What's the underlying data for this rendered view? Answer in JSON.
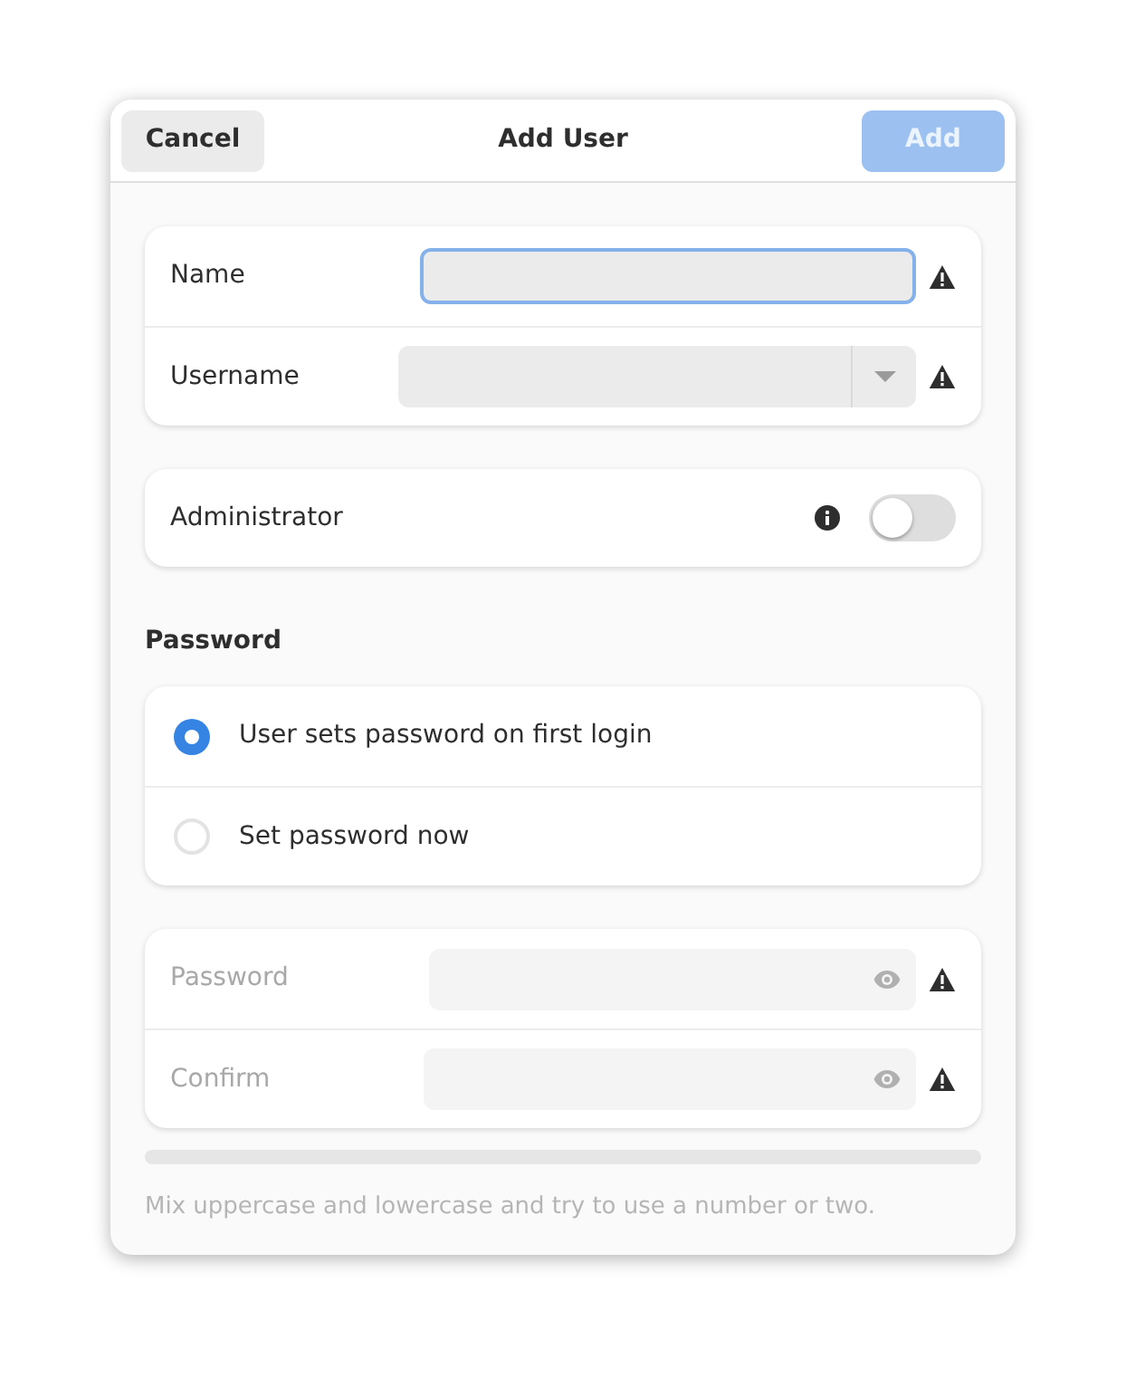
{
  "header": {
    "cancel": "Cancel",
    "title": "Add User",
    "add": {
      "label": "Add",
      "disabled": true
    }
  },
  "identity": [
    {
      "label": "Name",
      "kind": "entry",
      "focused": true
    },
    {
      "label": "Username",
      "kind": "combo",
      "focused": false
    }
  ],
  "administrator": {
    "label": "Administrator",
    "on": false
  },
  "password_section": {
    "title": "Password",
    "options": [
      {
        "label": "User sets password on first login",
        "selected": true
      },
      {
        "label": "Set password now",
        "selected": false
      }
    ]
  },
  "password_fields": [
    {
      "label": "Password",
      "disabled": true
    },
    {
      "label": "Confirm",
      "disabled": true
    }
  ],
  "strength": {
    "level": 0
  },
  "hint": "Mix uppercase and lowercase and try to use a number or two."
}
